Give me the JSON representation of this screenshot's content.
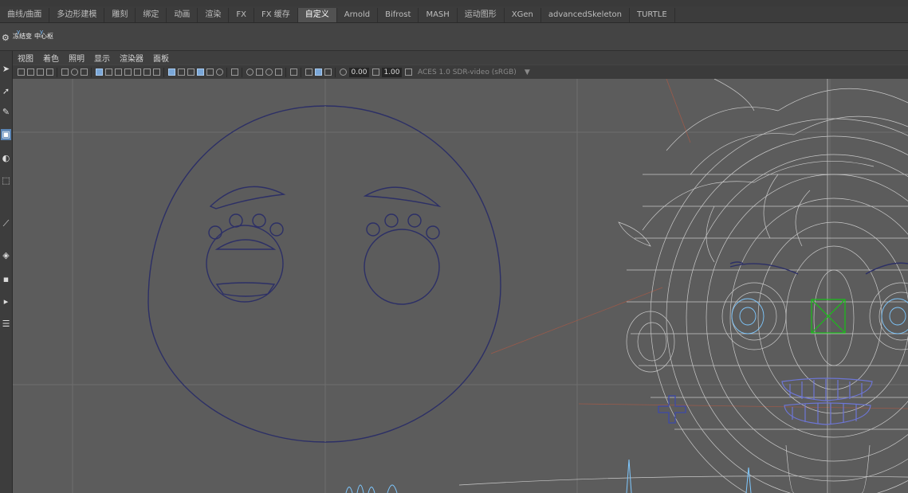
{
  "shelf_tabs": [
    {
      "label": "曲线/曲面",
      "active": false
    },
    {
      "label": "多边形建模",
      "active": false
    },
    {
      "label": "雕刻",
      "active": false
    },
    {
      "label": "绑定",
      "active": false
    },
    {
      "label": "动画",
      "active": false
    },
    {
      "label": "渲染",
      "active": false
    },
    {
      "label": "FX",
      "active": false
    },
    {
      "label": "FX 缓存",
      "active": false
    },
    {
      "label": "自定义",
      "active": true
    },
    {
      "label": "Arnold",
      "active": false
    },
    {
      "label": "Bifrost",
      "active": false
    },
    {
      "label": "MASH",
      "active": false
    },
    {
      "label": "运动图形",
      "active": false
    },
    {
      "label": "XGen",
      "active": false
    },
    {
      "label": "advancedSkeleton",
      "active": false
    },
    {
      "label": "TURTLE",
      "active": false
    }
  ],
  "shelf_buttons": [
    {
      "label": "冻结变",
      "axis": "y"
    },
    {
      "label": "中心枢",
      "axis": "y"
    }
  ],
  "panel_menu": [
    "视图",
    "着色",
    "照明",
    "显示",
    "渲染器",
    "面板"
  ],
  "panel_toolbar": {
    "exposure_value": "0.00",
    "gamma_value": "1.00",
    "color_management": "ACES 1.0 SDR-video (sRGB)",
    "dropdown_glyph": "▼"
  },
  "tool_icons": [
    "select-arrow",
    "lasso-select",
    "paint-select",
    "move-tool",
    "rotate-tool",
    "scale-tool",
    "soft-mod",
    "last-tool",
    "snap",
    "layout-single",
    "layout-four",
    "outliner"
  ],
  "viewport": {
    "background": "#5c5c5c",
    "grid_color": "#6e6e6e",
    "curve_color": "#2c2f66",
    "wire_color": "#dcdcdc",
    "control_color": "#18c018",
    "axis_color": "#9a5a4a"
  }
}
